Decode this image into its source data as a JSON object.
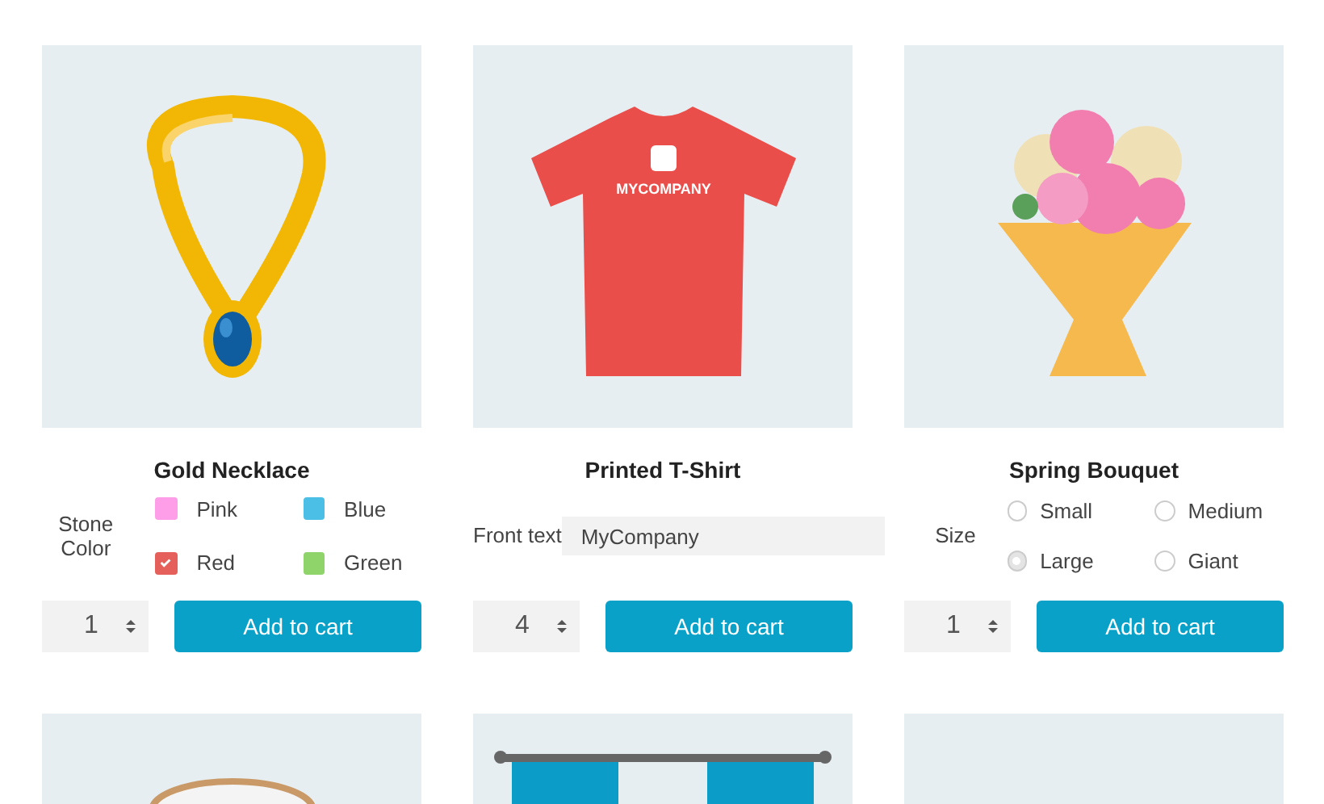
{
  "products": [
    {
      "kind": "picture",
      "title": "Gold Necklace",
      "option": {
        "kind": "checkboxes",
        "label": "Stone Color",
        "items": [
          {
            "label": "Pink",
            "color": "#ff9ee8",
            "checked": false
          },
          {
            "label": "Blue",
            "color": "#4bbfe6",
            "checked": false
          },
          {
            "label": "Red",
            "color": "#e5605b",
            "checked": true
          },
          {
            "label": "Green",
            "color": "#8fd36b",
            "checked": false
          }
        ]
      },
      "quantity": "1",
      "button": "Add to cart"
    },
    {
      "kind": "picture",
      "print_text": "MYCOMPANY",
      "title": "Printed T-Shirt",
      "option": {
        "kind": "text",
        "label": "Front text",
        "value": "MyCompany"
      },
      "quantity": "4",
      "button": "Add to cart"
    },
    {
      "kind": "picture",
      "title": "Spring Bouquet",
      "option": {
        "kind": "radios",
        "label": "Size",
        "items": [
          {
            "label": "Small",
            "selected": false
          },
          {
            "label": "Medium",
            "selected": false
          },
          {
            "label": "Large",
            "selected": true
          },
          {
            "label": "Giant",
            "selected": false
          }
        ]
      },
      "quantity": "1",
      "button": "Add to cart"
    },
    {
      "kind": "picture"
    },
    {
      "kind": "picture"
    },
    {
      "kind": "picture"
    }
  ]
}
